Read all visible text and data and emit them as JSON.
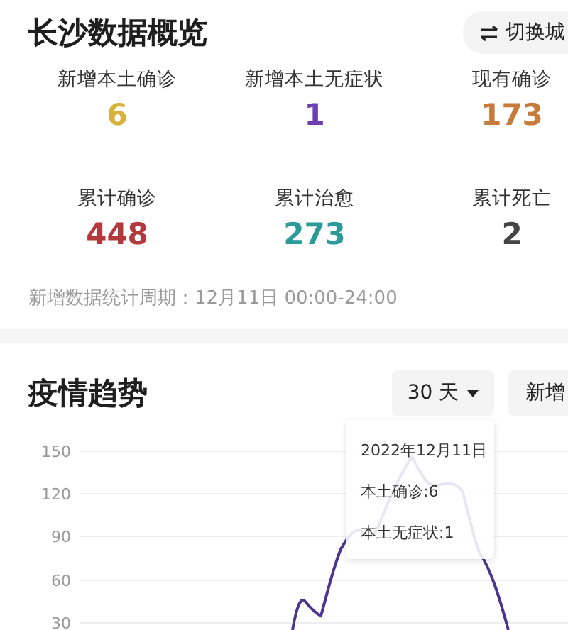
{
  "overview": {
    "title": "长沙数据概览",
    "switch_button": {
      "label": "切换城"
    },
    "stats": [
      {
        "label": "新增本土确诊",
        "value": "6",
        "color": "#d6b13c"
      },
      {
        "label": "新增本土无症状",
        "value": "1",
        "color": "#6b3fb3"
      },
      {
        "label": "现有确诊",
        "value": "173",
        "color": "#c77b3b"
      },
      {
        "label": "累计确诊",
        "value": "448",
        "color": "#b3393d"
      },
      {
        "label": "累计治愈",
        "value": "273",
        "color": "#2b9a98"
      },
      {
        "label": "累计死亡",
        "value": "2",
        "color": "#444444"
      }
    ],
    "period_note": "新增数据统计周期：12月11日 00:00-24:00"
  },
  "trend": {
    "title": "疫情趋势",
    "range_dropdown": {
      "label": "30 天"
    },
    "type_button": {
      "label": "新增"
    },
    "y_ticks": [
      "150",
      "120",
      "90",
      "60",
      "30"
    ],
    "tooltip": {
      "date": "2022年12月11日",
      "lines": [
        "本土确诊:6",
        "本土无症状:1"
      ]
    }
  }
}
